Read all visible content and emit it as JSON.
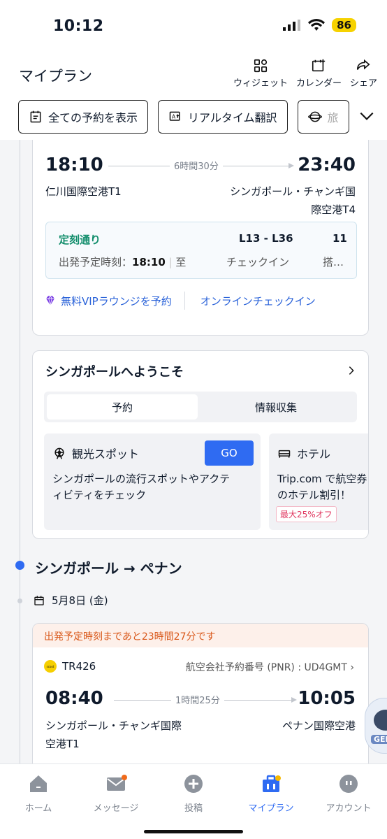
{
  "status_bar": {
    "time": "10:12",
    "battery": "86"
  },
  "header": {
    "title": "マイプラン",
    "actions": [
      {
        "label": "ウィジェット",
        "icon": "widget-icon"
      },
      {
        "label": "カレンダー",
        "icon": "calendar-add-icon"
      },
      {
        "label": "シェア",
        "icon": "share-icon"
      }
    ],
    "chips": [
      {
        "label": "全ての予約を表示",
        "icon": "list-icon"
      },
      {
        "label": "リアルタイム翻訳",
        "icon": "translate-icon"
      },
      {
        "label": "旅",
        "icon": "globe-icon"
      }
    ]
  },
  "flight1": {
    "dep_time": "18:10",
    "arr_time": "23:40",
    "duration": "6時間30分",
    "dep_airport": "仁川国際空港T1",
    "arr_airport_line1": "シンガポール・チャンギ国",
    "arr_airport_line2": "際空港T4",
    "status": "定刻通り",
    "gate_range": "L13 - L36",
    "gate_num": "11",
    "dep_label": "出発予定時刻：",
    "dep_value": "18:10",
    "dep_sep": "至",
    "checkin_label": "チェックイン",
    "board_label": "搭…",
    "vip_link": "無料VIPラウンジを予約",
    "online_checkin": "オンラインチェックイン"
  },
  "welcome": {
    "title": "シンガポールへようこそ",
    "tabs": [
      "予約",
      "情報収集"
    ],
    "sightseeing": {
      "title": "観光スポット",
      "go": "GO",
      "line1": "シンガポールの流行スポットやアクテ",
      "line2": "ィビティをチェック"
    },
    "hotel": {
      "title": "ホテル",
      "line1": "Trip.com で航空券",
      "line2": "のホテル割引！",
      "promo": "最大25%オフ"
    }
  },
  "segment2": {
    "route": "シンガポール → ペナン",
    "date": "5月8日 (金)",
    "warning": "出発予定時刻まであと23時間27分です",
    "airline_logo": "scoot",
    "flight_no": "TR426",
    "pnr": "航空会社予約番号 (PNR) : UD4GMT",
    "dep_time": "08:40",
    "arr_time": "10:05",
    "duration": "1時間25分",
    "dep_airport_line1": "シンガポール・チャンギ国際",
    "dep_airport_line2": "空港T1",
    "arr_airport": "ペナン国際空港"
  },
  "assistant_bubble": {
    "label": "GEN"
  },
  "nav": [
    {
      "label": "ホーム",
      "icon": "home-icon"
    },
    {
      "label": "メッセージ",
      "icon": "message-icon"
    },
    {
      "label": "投稿",
      "icon": "post-icon"
    },
    {
      "label": "マイプラン",
      "icon": "myplan-icon"
    },
    {
      "label": "アカウント",
      "icon": "account-icon"
    }
  ],
  "colors": {
    "accent": "#2f6bf2",
    "ontime": "#0f8c6a",
    "warning": "#d9581a",
    "promo": "#e0365f"
  }
}
